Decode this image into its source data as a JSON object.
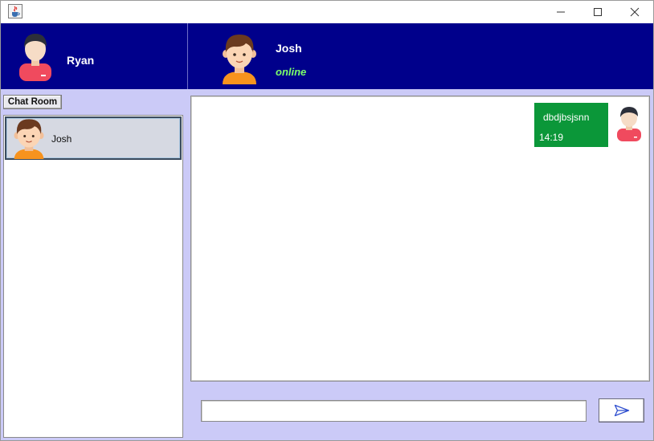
{
  "window": {
    "icons": {
      "app": "java-cup-icon",
      "minimize": "minimize-icon",
      "maximize": "maximize-icon",
      "close": "close-icon"
    }
  },
  "header": {
    "current_user": {
      "name": "Ryan",
      "avatar_icon": "user-avatar-icon"
    },
    "peer": {
      "name": "Josh",
      "status": "online",
      "avatar_icon": "user-avatar-icon"
    }
  },
  "sidebar": {
    "chat_room_label": "Chat Room",
    "contacts": [
      {
        "name": "Josh",
        "selected": true,
        "avatar_icon": "user-avatar-icon"
      }
    ]
  },
  "chat": {
    "messages": [
      {
        "text": "dbdjbsjsnn",
        "time": "14:19",
        "sender": "Ryan",
        "outgoing": true
      }
    ]
  },
  "composer": {
    "input_value": "",
    "send_icon": "send-icon"
  },
  "colors": {
    "header_bg": "#00008b",
    "window_bg": "#cbcaf7",
    "bubble_bg": "#0b9739",
    "status_online": "#7cff6a",
    "selected_contact_bg": "#d6d9e2"
  }
}
